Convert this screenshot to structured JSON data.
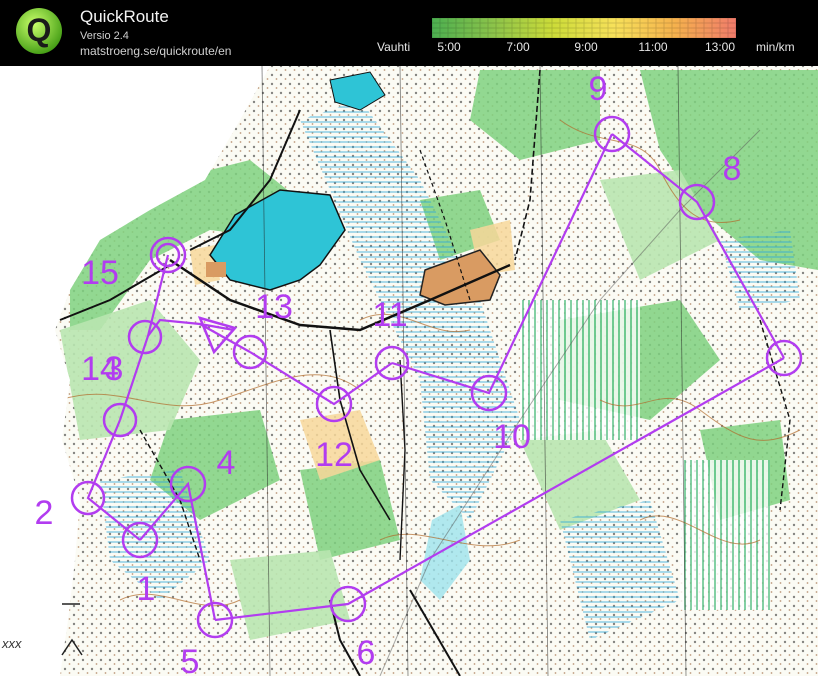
{
  "header": {
    "title": "QuickRoute",
    "version": "Versio 2.4",
    "url": "matstroeng.se/quickroute/en"
  },
  "pace_scale": {
    "label": "Vauhti",
    "ticks": [
      "5:00",
      "7:00",
      "9:00",
      "11:00",
      "13:00"
    ],
    "unit": "min/km",
    "colors": [
      "#4caf50",
      "#8bc34a",
      "#cddc39",
      "#f7e15a",
      "#f5b14d",
      "#f07b6b"
    ]
  },
  "map": {
    "course_color": "#b23cf0",
    "controls": [
      {
        "id": "1",
        "label": "1"
      },
      {
        "id": "2",
        "label": "2"
      },
      {
        "id": "3",
        "label": "3"
      },
      {
        "id": "4",
        "label": "4"
      },
      {
        "id": "5",
        "label": "5"
      },
      {
        "id": "6",
        "label": "6"
      },
      {
        "id": "7",
        "label": ""
      },
      {
        "id": "8",
        "label": "8"
      },
      {
        "id": "9",
        "label": "9"
      },
      {
        "id": "10",
        "label": "10"
      },
      {
        "id": "11",
        "label": "11"
      },
      {
        "id": "12",
        "label": "12"
      },
      {
        "id": "13",
        "label": "13"
      },
      {
        "id": "14",
        "label": "14"
      },
      {
        "id": "15",
        "label": "15"
      }
    ],
    "corner_text": "xxx"
  }
}
